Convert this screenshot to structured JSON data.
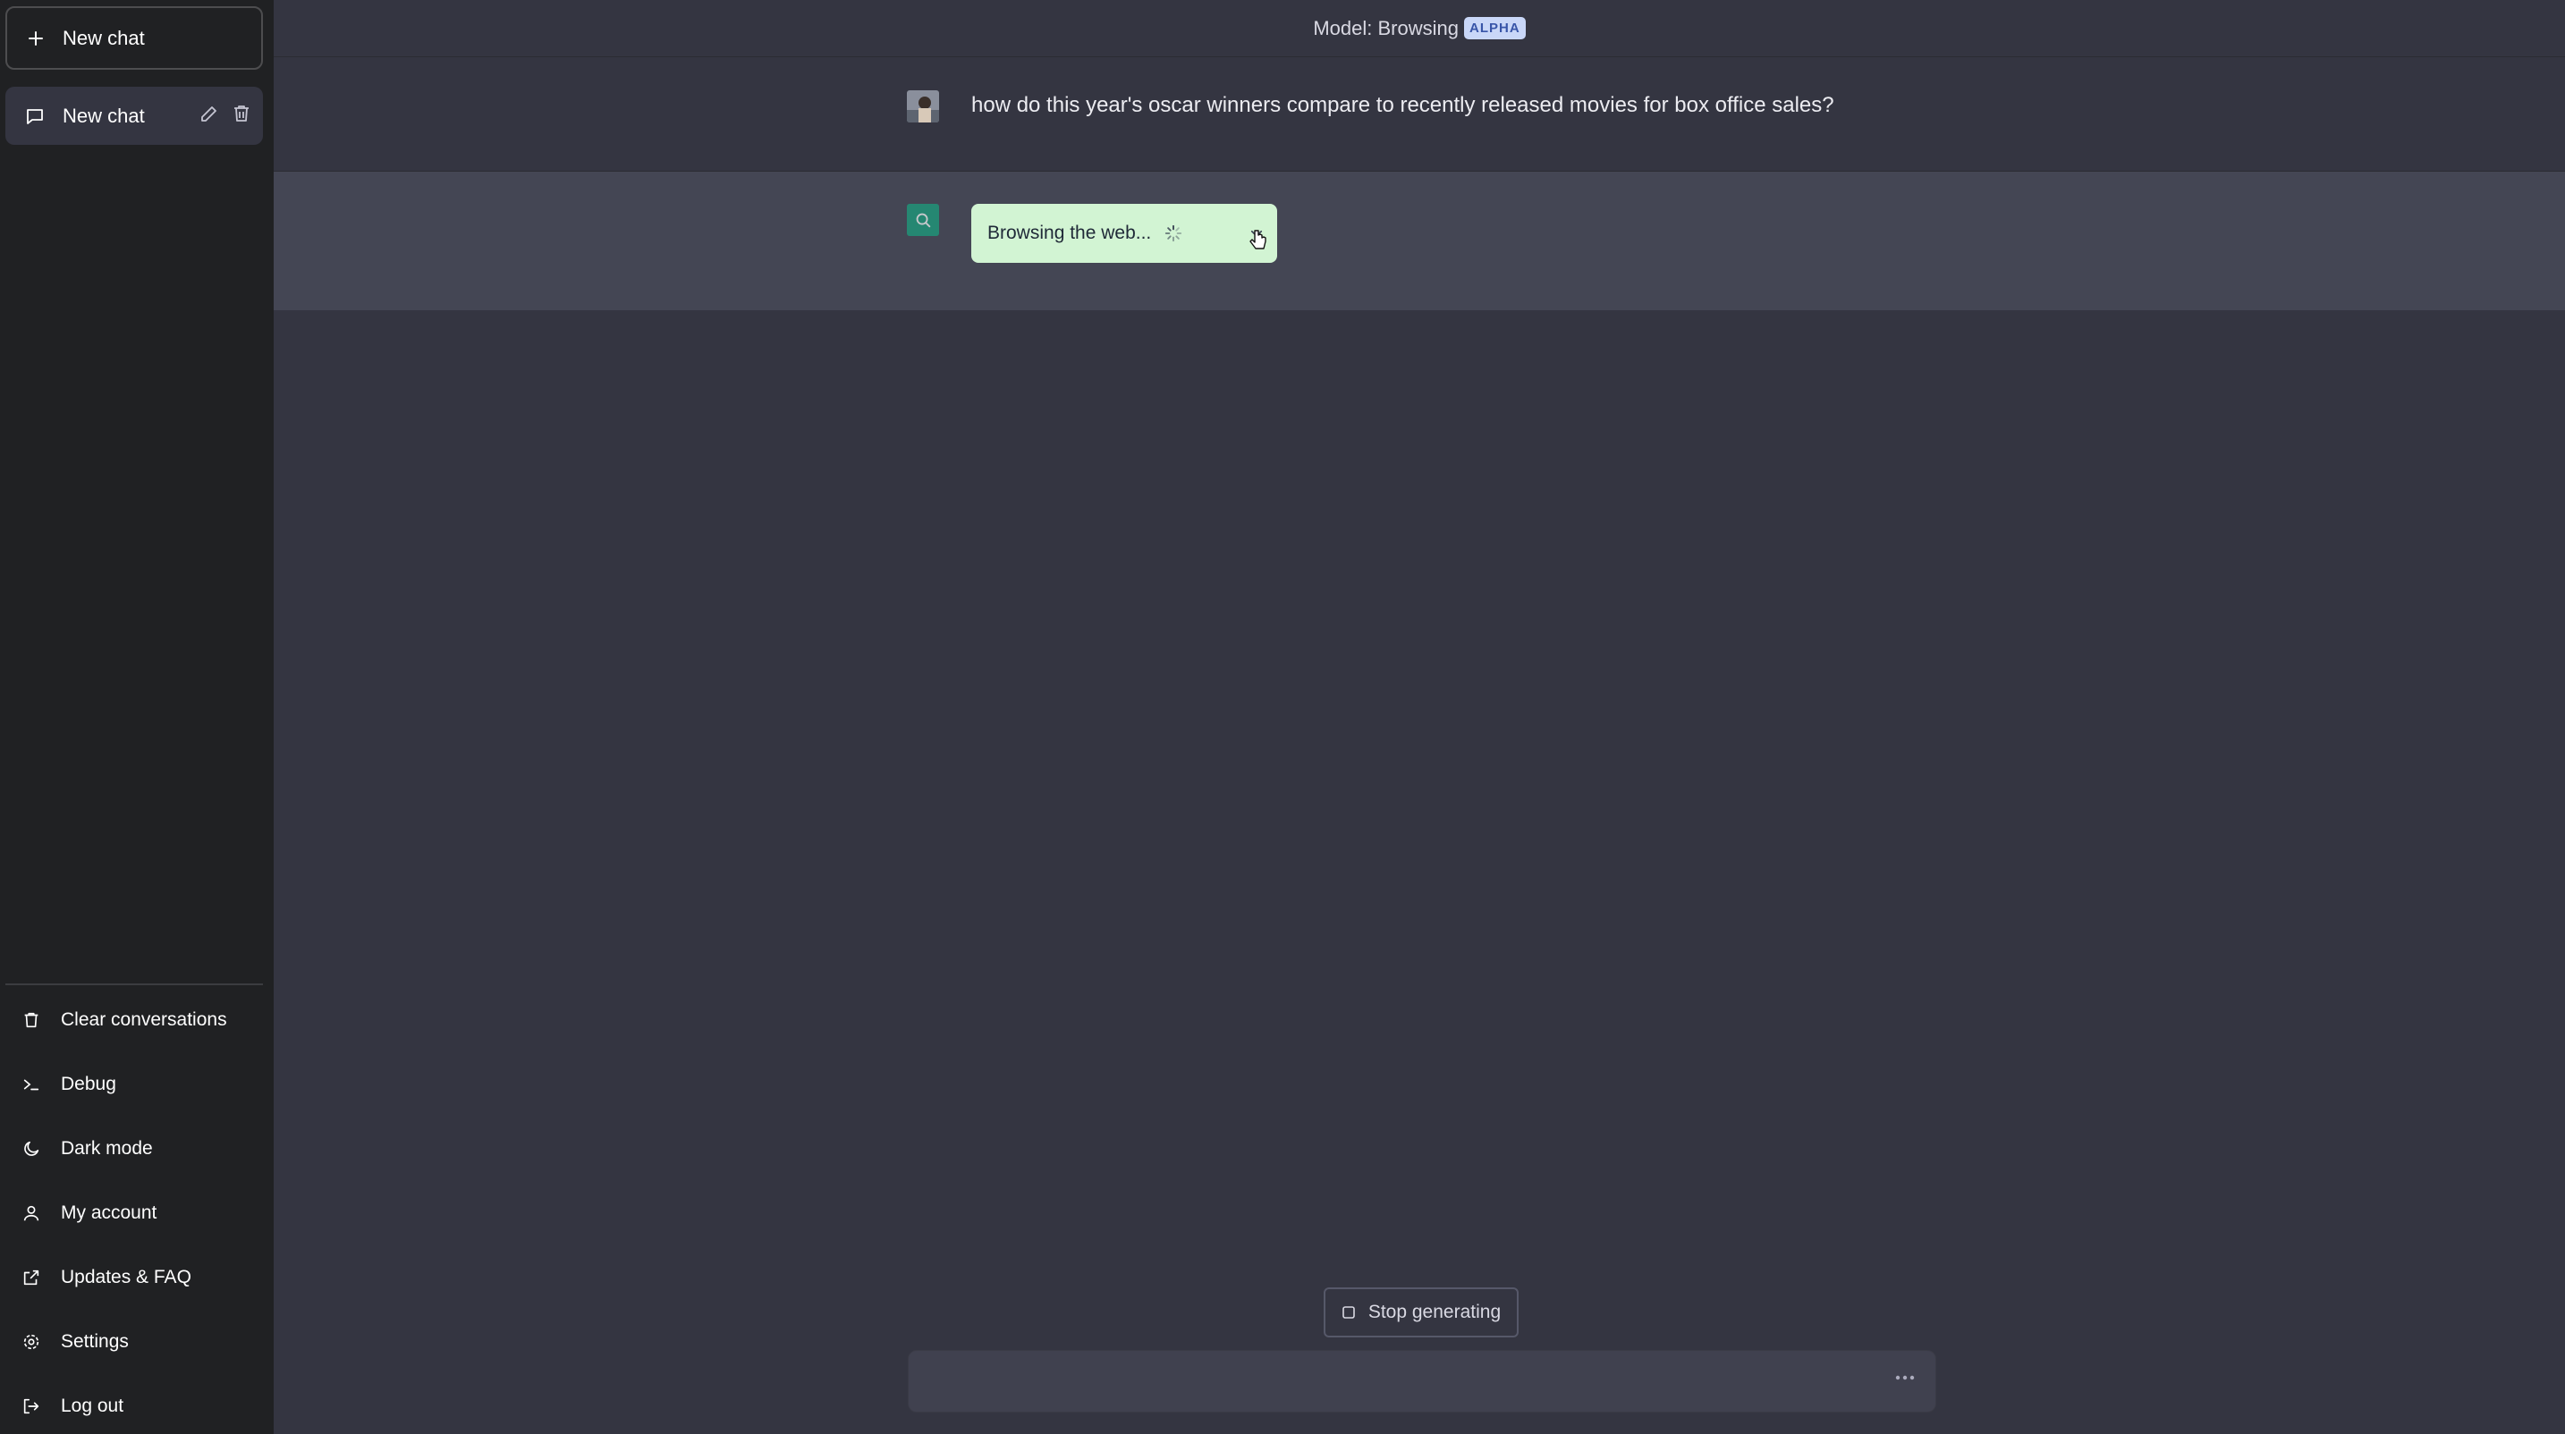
{
  "sidebar": {
    "new_chat_label": "New chat",
    "chats": [
      {
        "label": "New chat"
      }
    ],
    "menu": [
      {
        "label": "Clear conversations",
        "icon": "trash-icon"
      },
      {
        "label": "Debug",
        "icon": "terminal-icon"
      },
      {
        "label": "Dark mode",
        "icon": "moon-icon"
      },
      {
        "label": "My account",
        "icon": "user-icon"
      },
      {
        "label": "Updates & FAQ",
        "icon": "external-link-icon"
      },
      {
        "label": "Settings",
        "icon": "gear-icon"
      },
      {
        "label": "Log out",
        "icon": "logout-icon"
      }
    ]
  },
  "header": {
    "model_label": "Model: Browsing",
    "badge": "ALPHA"
  },
  "messages": {
    "user_text": "how do this year's oscar winners compare to recently released movies for box office sales?",
    "bot_status": "Browsing the web..."
  },
  "controls": {
    "stop_label": "Stop generating"
  },
  "colors": {
    "sidebar": "#202123",
    "main": "#343541",
    "bot_row": "#444654",
    "browse_box": "#d2f4d3",
    "accent": "#19a37f"
  }
}
